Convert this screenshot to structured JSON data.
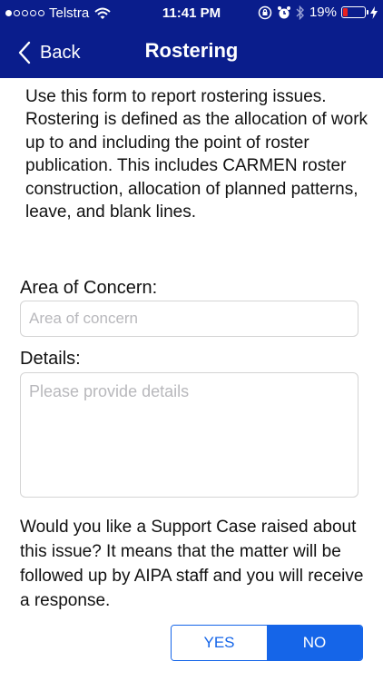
{
  "status_bar": {
    "carrier": "Telstra",
    "time": "11:41 PM",
    "battery": "19%",
    "signal_bars_filled": 1,
    "signal_bars_total": 5
  },
  "nav": {
    "back_label": "Back",
    "title": "Rostering"
  },
  "form": {
    "intro": "Use this form to report rostering issues. Rostering is defined as the allocation of work up to and including the point of roster publication. This includes CARMEN roster construction, allocation of planned patterns, leave, and blank lines.",
    "area_label": "Area of Concern:",
    "area_placeholder": "Area of concern",
    "area_value": "",
    "details_label": "Details:",
    "details_placeholder": "Please provide details",
    "details_value": "",
    "support_question": "Would you like a Support Case raised about this issue? It means that the matter will be followed up by AIPA staff and you will receive a response.",
    "yes_label": "YES",
    "no_label": "NO",
    "selected": "NO"
  },
  "colors": {
    "header": "#0a1d8c",
    "accent": "#1565e8",
    "battery_low": "#e82020"
  },
  "icons": [
    "wifi-icon",
    "lock-rotation-icon",
    "alarm-icon",
    "bluetooth-icon",
    "battery-icon",
    "charging-icon",
    "chevron-left-icon"
  ]
}
